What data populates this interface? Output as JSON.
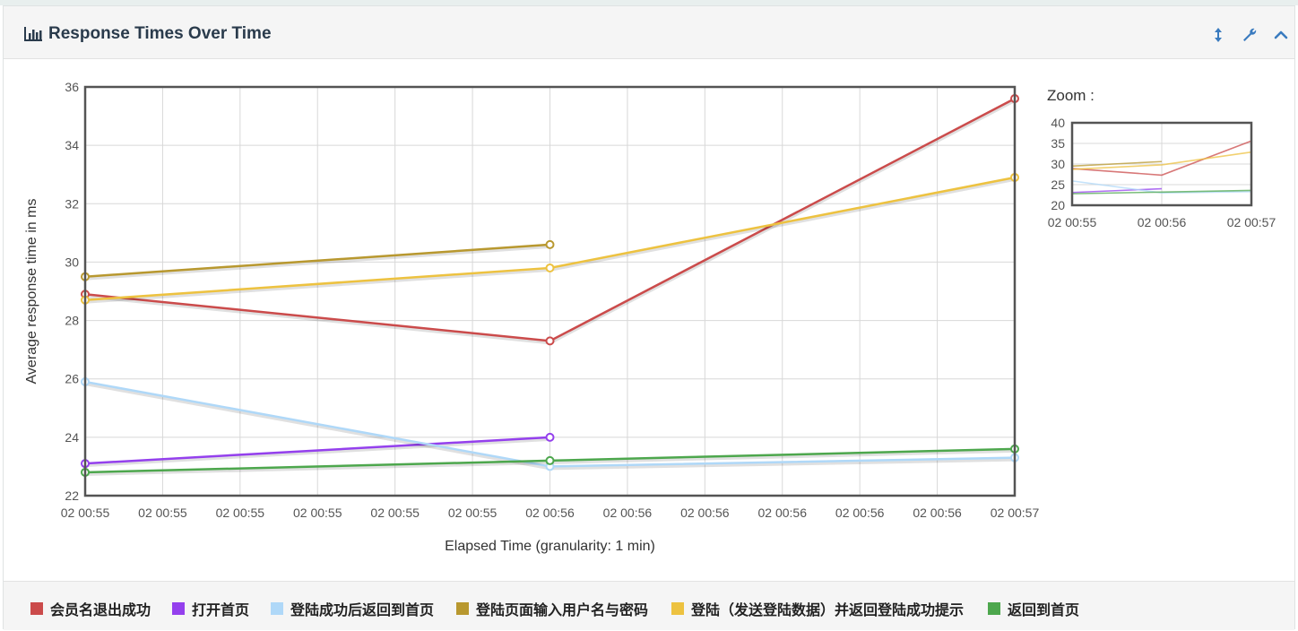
{
  "panel": {
    "title": "Response Times Over Time"
  },
  "zoom": {
    "label": "Zoom :",
    "yticks": [
      "20",
      "25",
      "30",
      "35",
      "40"
    ],
    "xticks": [
      "02 00:55",
      "02 00:56",
      "02 00:57"
    ]
  },
  "colors": {
    "series": [
      "#cb4b4b",
      "#9440ed",
      "#afd8f8",
      "#b8982f",
      "#edc240",
      "#4da74d"
    ],
    "grid": "#d8d8d8",
    "frame": "#545454"
  },
  "icons": [
    "chart-bar-icon",
    "resize-vertical-icon",
    "wrench-icon",
    "chevron-up-icon"
  ],
  "chart_data": {
    "type": "line",
    "xlabel": "Elapsed Time (granularity: 1 min)",
    "ylabel": "Average response time in ms",
    "ylim": [
      22,
      36
    ],
    "yticks": [
      22,
      24,
      26,
      28,
      30,
      32,
      34,
      36
    ],
    "x_ticks": [
      "02 00:55",
      "02 00:55",
      "02 00:55",
      "02 00:55",
      "02 00:55",
      "02 00:55",
      "02 00:56",
      "02 00:56",
      "02 00:56",
      "02 00:56",
      "02 00:56",
      "02 00:56",
      "02 00:57"
    ],
    "x": [
      "02 00:55",
      "02 00:56",
      "02 00:57"
    ],
    "grid": true,
    "series": [
      {
        "name": "会员名退出成功",
        "values": [
          28.9,
          27.3,
          35.6
        ]
      },
      {
        "name": "打开首页",
        "values": [
          23.1,
          24.0,
          null
        ]
      },
      {
        "name": "登陆成功后返回到首页",
        "values": [
          25.9,
          23.0,
          23.3
        ]
      },
      {
        "name": "登陆页面输入用户名与密码",
        "values": [
          29.5,
          30.6,
          null
        ]
      },
      {
        "name": "登陆（发送登陆数据）并返回登陆成功提示",
        "values": [
          28.7,
          29.8,
          32.9
        ]
      },
      {
        "name": "返回到首页",
        "values": [
          22.8,
          23.2,
          23.6
        ]
      }
    ]
  }
}
